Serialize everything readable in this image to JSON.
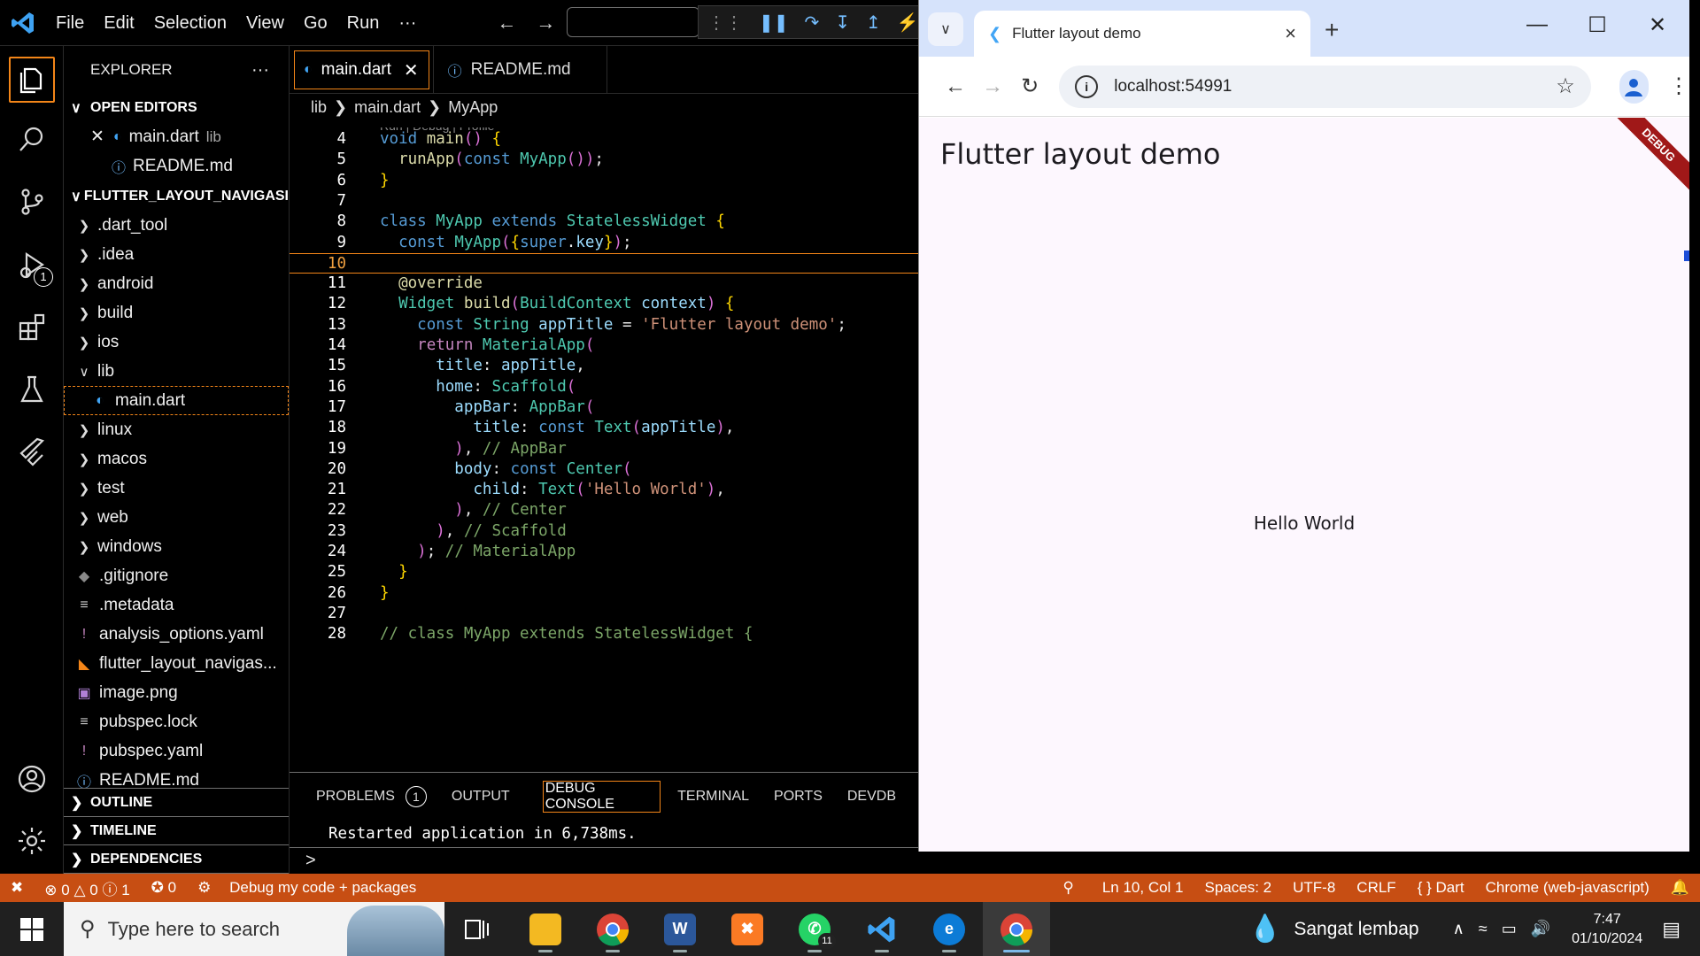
{
  "vscode": {
    "menu": [
      "File",
      "Edit",
      "Selection",
      "View",
      "Go",
      "Run",
      "···"
    ],
    "explorer": {
      "title": "EXPLORER",
      "more": "···",
      "open_editors_title": "OPEN EDITORS",
      "open_editors": [
        {
          "name": "main.dart",
          "hint": "lib"
        },
        {
          "name": "README.md",
          "hint": ""
        }
      ],
      "project_title": "FLUTTER_LAYOUT_NAVIGASI",
      "tree": [
        {
          "name": ".dart_tool",
          "type": "folder"
        },
        {
          "name": ".idea",
          "type": "folder"
        },
        {
          "name": "android",
          "type": "folder"
        },
        {
          "name": "build",
          "type": "folder"
        },
        {
          "name": "ios",
          "type": "folder"
        },
        {
          "name": "lib",
          "type": "folder-open"
        },
        {
          "name": "main.dart",
          "type": "dart"
        },
        {
          "name": "linux",
          "type": "folder"
        },
        {
          "name": "macos",
          "type": "folder"
        },
        {
          "name": "test",
          "type": "folder"
        },
        {
          "name": "web",
          "type": "folder"
        },
        {
          "name": "windows",
          "type": "folder"
        },
        {
          "name": ".gitignore",
          "type": "git"
        },
        {
          "name": ".metadata",
          "type": "text"
        },
        {
          "name": "analysis_options.yaml",
          "type": "yaml"
        },
        {
          "name": "flutter_layout_navigas...",
          "type": "rss"
        },
        {
          "name": "image.png",
          "type": "image"
        },
        {
          "name": "pubspec.lock",
          "type": "text"
        },
        {
          "name": "pubspec.yaml",
          "type": "yaml"
        },
        {
          "name": "README.md",
          "type": "info"
        }
      ],
      "bottom_sections": [
        "OUTLINE",
        "TIMELINE",
        "DEPENDENCIES"
      ]
    },
    "tabs": [
      {
        "label": "main.dart",
        "active": true
      },
      {
        "label": "README.md",
        "active": false
      }
    ],
    "breadcrumb": [
      "lib",
      "main.dart",
      "MyApp"
    ],
    "codelens": "Run | Debug | Profile",
    "code_lines": [
      {
        "n": "4",
        "text": "void main() {"
      },
      {
        "n": "5",
        "text": "  runApp(const MyApp());"
      },
      {
        "n": "6",
        "text": "}"
      },
      {
        "n": "7",
        "text": ""
      },
      {
        "n": "8",
        "text": "class MyApp extends StatelessWidget {"
      },
      {
        "n": "9",
        "text": "  const MyApp({super.key});"
      },
      {
        "n": "10",
        "text": ""
      },
      {
        "n": "11",
        "text": "  @override"
      },
      {
        "n": "12",
        "text": "  Widget build(BuildContext context) {"
      },
      {
        "n": "13",
        "text": "    const String appTitle = 'Flutter layout demo';"
      },
      {
        "n": "14",
        "text": "    return MaterialApp("
      },
      {
        "n": "15",
        "text": "      title: appTitle,"
      },
      {
        "n": "16",
        "text": "      home: Scaffold("
      },
      {
        "n": "17",
        "text": "        appBar: AppBar("
      },
      {
        "n": "18",
        "text": "          title: const Text(appTitle),"
      },
      {
        "n": "19",
        "text": "        ), // AppBar"
      },
      {
        "n": "20",
        "text": "        body: const Center("
      },
      {
        "n": "21",
        "text": "          child: Text('Hello World'),"
      },
      {
        "n": "22",
        "text": "        ), // Center"
      },
      {
        "n": "23",
        "text": "      ), // Scaffold"
      },
      {
        "n": "24",
        "text": "    ); // MaterialApp"
      },
      {
        "n": "25",
        "text": "  }"
      },
      {
        "n": "26",
        "text": "}"
      },
      {
        "n": "27",
        "text": ""
      },
      {
        "n": "28",
        "text": "// class MyApp extends StatelessWidget {"
      }
    ],
    "current_line": "10",
    "panel": {
      "tabs": [
        "PROBLEMS",
        "OUTPUT",
        "DEBUG CONSOLE",
        "TERMINAL",
        "PORTS",
        "DEVDB"
      ],
      "problems_count": "1",
      "active_tab": "DEBUG CONSOLE",
      "output": "Restarted application in 6,738ms.",
      "prompt": ">"
    },
    "status": {
      "errors": "0",
      "warnings": "0",
      "infos": "1",
      "ports": "0",
      "debug": "Debug my code + packages",
      "position": "Ln 10, Col 1",
      "spaces": "Spaces: 2",
      "encoding": "UTF-8",
      "eol": "CRLF",
      "language": "Dart",
      "device": "Chrome (web-javascript)"
    },
    "activity_badge": "1"
  },
  "browser": {
    "tab_title": "Flutter layout demo",
    "url": "localhost:54991",
    "app_title": "Flutter layout demo",
    "body_text": "Hello World",
    "debug_banner": "DEBUG"
  },
  "taskbar": {
    "search_placeholder": "Type here to search",
    "whatsapp_badge": "11",
    "weather": "Sangat lembap",
    "time": "7:47",
    "date": "01/10/2024"
  },
  "colors": {
    "accent": "#f38518",
    "statusbar": "#c74e13",
    "flutter_bg": "#fdf7fe",
    "chrome_tabstrip": "#d6e3fb"
  }
}
